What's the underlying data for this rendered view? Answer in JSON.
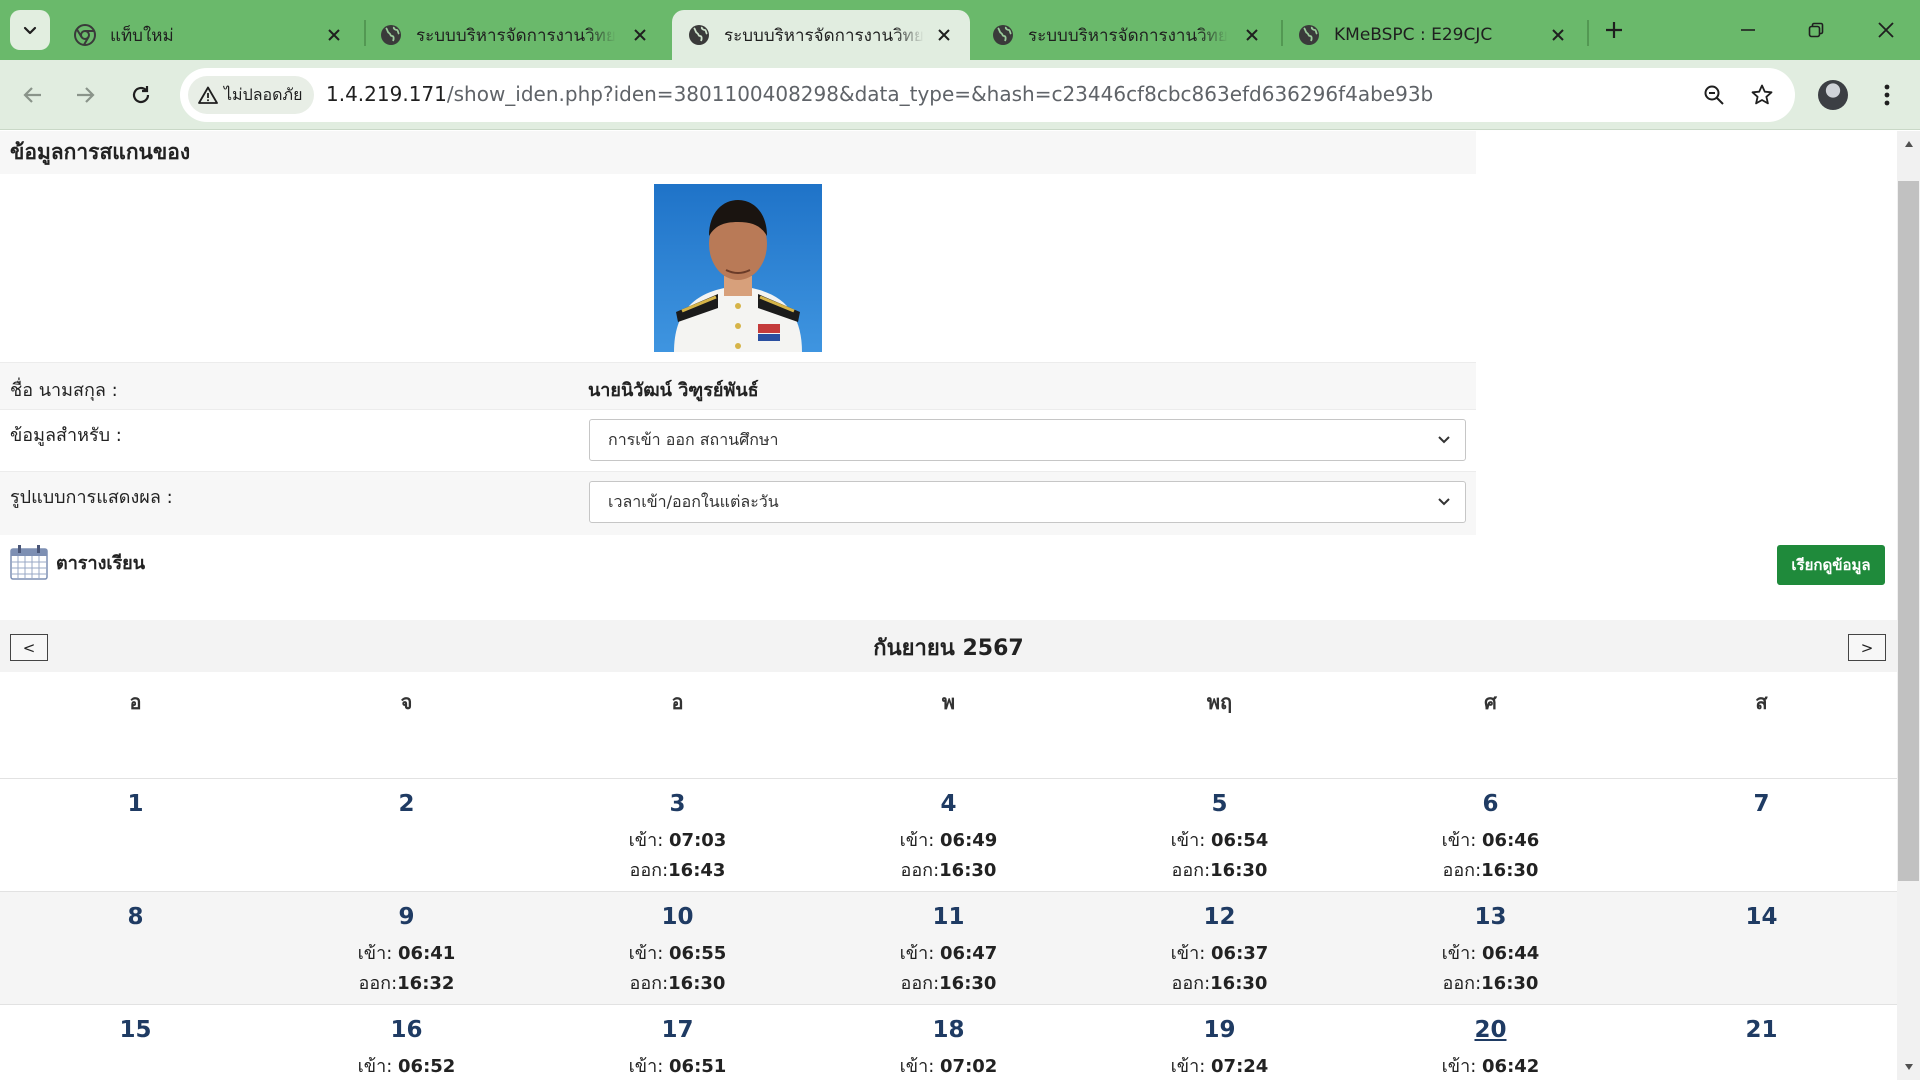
{
  "browser": {
    "tabs": [
      {
        "title": "แท็บใหม่",
        "active": false
      },
      {
        "title": "ระบบบริหารจัดการงานวิทยาลัย",
        "active": false
      },
      {
        "title": "ระบบบริหารจัดการงานวิทยาลัย",
        "active": true
      },
      {
        "title": "ระบบบริหารจัดการงานวิทยาลัย",
        "active": false
      },
      {
        "title": "KMeBSPC : E29CJC",
        "active": false
      }
    ],
    "security_label": "ไม่ปลอดภัย",
    "url_host": "1.4.219.171",
    "url_path": "/show_iden.php?iden=3801100408298&data_type=&hash=c23446cf8cbc863efd636296f4abe93b"
  },
  "page": {
    "heading": "ข้อมูลการสแกนของ",
    "name_label": "ชื่อ นามสกุล :",
    "name_value": "นายนิวัฒน์ วิฑูรย์พันธ์",
    "data_for_label": "ข้อมูลสำหรับ :",
    "data_for_value": "การเข้า ออก สถานศึกษา",
    "display_label": "รูปแบบการแสดงผล :",
    "display_value": "เวลาเข้า/ออกในแต่ละวัน",
    "schedule_label": "ตารางเรียน",
    "fetch_button": "เรียกดูข้อมูล"
  },
  "calendar": {
    "prev": "<",
    "next": ">",
    "month": "กันยายน 2567",
    "weekdays": [
      "อ",
      "จ",
      "อ",
      "พ",
      "พฤ",
      "ศ",
      "ส"
    ],
    "in_label": "เข้า:",
    "out_label": "ออก:",
    "weeks": [
      [
        {
          "day": "1"
        },
        {
          "day": "2"
        },
        {
          "day": "3",
          "in": "07:03",
          "out": "16:43"
        },
        {
          "day": "4",
          "in": "06:49",
          "out": "16:30"
        },
        {
          "day": "5",
          "in": "06:54",
          "out": "16:30"
        },
        {
          "day": "6",
          "in": "06:46",
          "out": "16:30"
        },
        {
          "day": "7"
        }
      ],
      [
        {
          "day": "8"
        },
        {
          "day": "9",
          "in": "06:41",
          "out": "16:32"
        },
        {
          "day": "10",
          "in": "06:55",
          "out": "16:30"
        },
        {
          "day": "11",
          "in": "06:47",
          "out": "16:30"
        },
        {
          "day": "12",
          "in": "06:37",
          "out": "16:30"
        },
        {
          "day": "13",
          "in": "06:44",
          "out": "16:30"
        },
        {
          "day": "14"
        }
      ],
      [
        {
          "day": "15"
        },
        {
          "day": "16",
          "in": "06:52"
        },
        {
          "day": "17",
          "in": "06:51"
        },
        {
          "day": "18",
          "in": "07:02"
        },
        {
          "day": "19",
          "in": "07:24"
        },
        {
          "day": "20",
          "in": "06:42",
          "today": true
        },
        {
          "day": "21"
        }
      ]
    ]
  }
}
